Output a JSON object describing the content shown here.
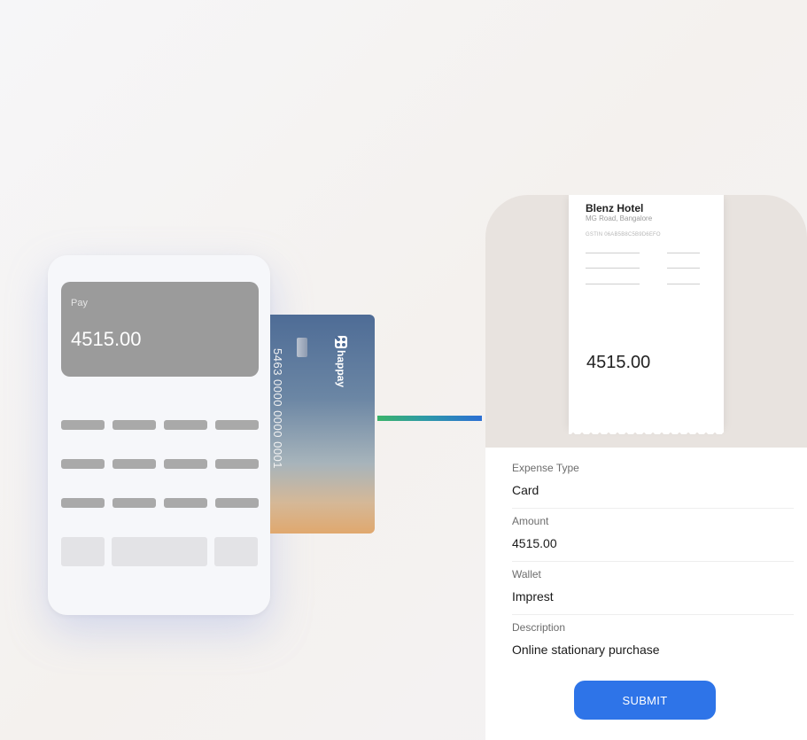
{
  "terminal": {
    "pay_label": "Pay",
    "pay_amount": "4515.00"
  },
  "card": {
    "number": "5463 0000 0000 0001",
    "brand": "happay"
  },
  "receipt": {
    "merchant": "Blenz Hotel",
    "address": "MG Road, Bangalore",
    "gstin": "GSTIN 06AB5B8C5B9D6EFO",
    "amount": "4515.00"
  },
  "form": {
    "fields": [
      {
        "label": "Expense Type",
        "value": "Card"
      },
      {
        "label": "Amount",
        "value": "4515.00"
      },
      {
        "label": "Wallet",
        "value": "Imprest"
      },
      {
        "label": "Description",
        "value": "Online stationary purchase"
      }
    ],
    "submit_label": "SUBMIT"
  },
  "colors": {
    "accent": "#2e74e8",
    "connector_start": "#3bb36a",
    "connector_end": "#2c6fd4"
  }
}
